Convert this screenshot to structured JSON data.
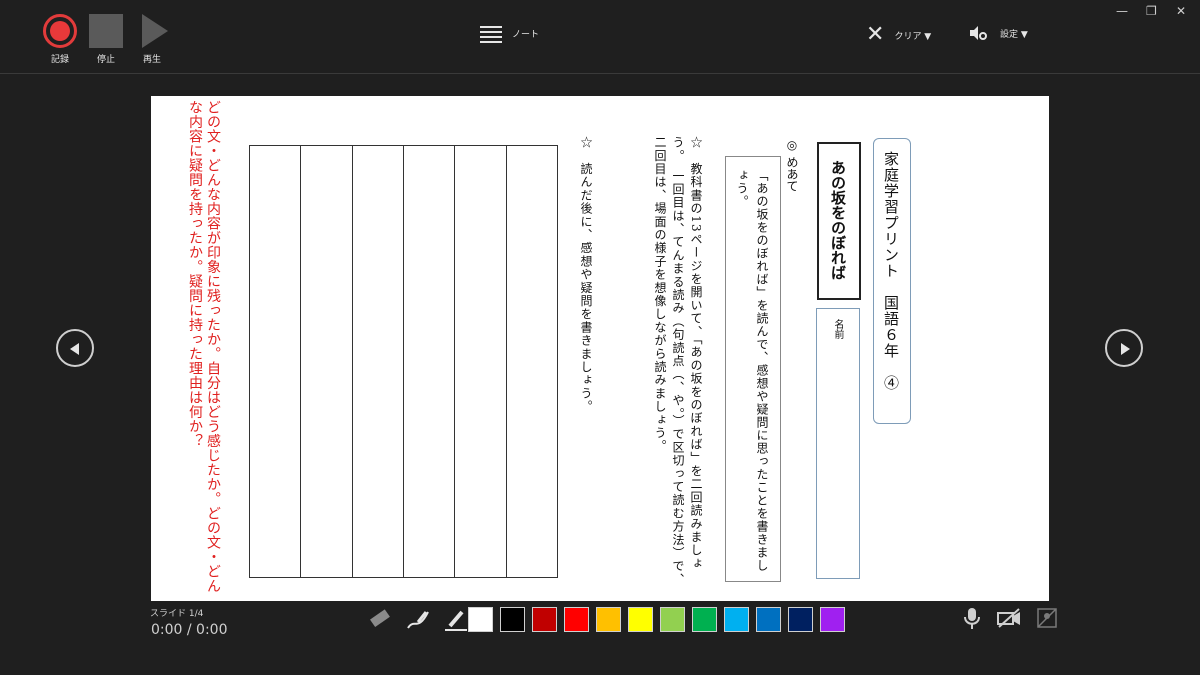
{
  "toolbar": {
    "record_label": "記録",
    "stop_label": "停止",
    "play_label": "再生",
    "note_label": "ノート",
    "clear_label": "クリア ▼",
    "settings_label": "設定 ▼"
  },
  "slide": {
    "title": "家庭学習プリント　国語６年　④",
    "topic": "あの坂をのぼれば",
    "name_label": "名前",
    "goal_heading": "◎ めあて",
    "goal_text": "「あの坂をのぼれば」を読んで、感想や疑問に思ったことを書きましょう。",
    "instruction1": "☆　教科書の13ページを開いて、「あの坂をのぼれば」を二回読みましょう。　一回目は、てんまる読み（句読点（、や。）で区切って読む方法）で、二回目は、場面の様子を想像しながら読みましょう。",
    "instruction2": "☆　読んだ後に、感想や疑問を書きましょう。",
    "red_note": "どの文・どんな内容が印象に残ったか。自分はどう感じたか。どの文・どんな内容に疑問を持ったか。疑問に持った理由は何か？"
  },
  "footer": {
    "slide_counter": "スライド 1/4",
    "timer": "0:00 / 0:00",
    "colors": [
      "#ffffff",
      "#000000",
      "#c00000",
      "#ff0000",
      "#ffc000",
      "#ffff00",
      "#92d050",
      "#00b050",
      "#00b0f0",
      "#0070c0",
      "#002060",
      "#a020f0"
    ]
  }
}
